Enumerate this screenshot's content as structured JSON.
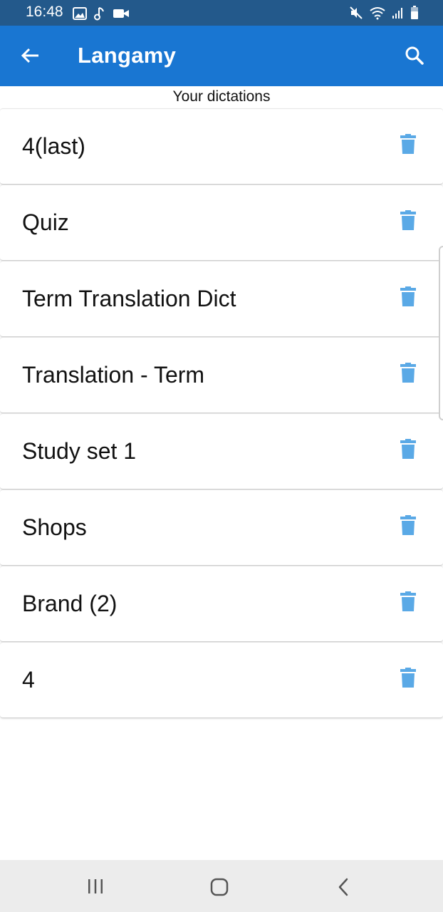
{
  "status_bar": {
    "time": "16:48",
    "left_icons": [
      "image-icon",
      "music-note-icon",
      "video-camera-icon"
    ],
    "right_icons": [
      "mute-icon",
      "wifi-icon",
      "signal-icon",
      "battery-icon"
    ]
  },
  "app_bar": {
    "title": "Langamy",
    "back_icon": "arrow-left-icon",
    "search_icon": "search-icon",
    "color": "#1976d2"
  },
  "section": {
    "heading": "Your dictations"
  },
  "dictations": [
    {
      "title": "4(last)"
    },
    {
      "title": "Quiz"
    },
    {
      "title": "Term Translation Dict"
    },
    {
      "title": "Translation - Term"
    },
    {
      "title": "Study set 1"
    },
    {
      "title": "Shops"
    },
    {
      "title": "Brand (2)"
    },
    {
      "title": "4"
    }
  ],
  "delete_icon": "trash-icon",
  "delete_icon_color": "#5aa9e6",
  "nav_bar": {
    "icons": [
      "recent-apps-icon",
      "home-icon",
      "back-icon"
    ]
  }
}
